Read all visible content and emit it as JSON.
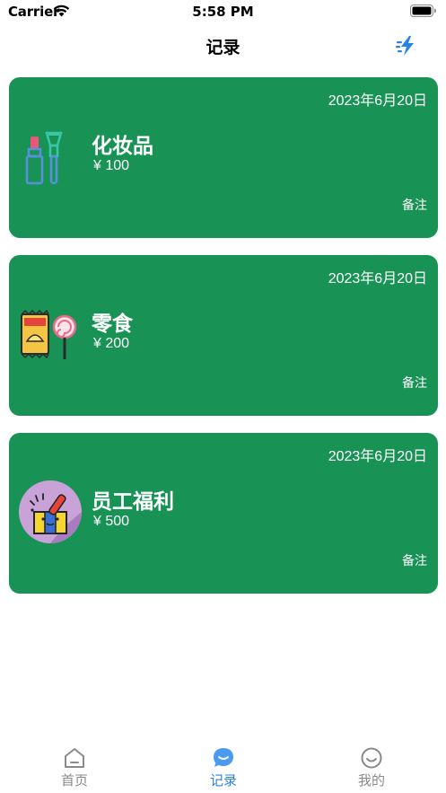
{
  "status_bar": {
    "carrier": "Carrier",
    "time": "5:58 PM"
  },
  "nav": {
    "title": "记录",
    "action_icon": "lightning-icon"
  },
  "records": [
    {
      "date": "2023年6月20日",
      "name": "化妆品",
      "amount": "¥ 100",
      "note": "备注",
      "icon": "cosmetics-icon"
    },
    {
      "date": "2023年6月20日",
      "name": "零食",
      "amount": "¥ 200",
      "note": "备注",
      "icon": "snacks-icon"
    },
    {
      "date": "2023年6月20日",
      "name": "员工福利",
      "amount": "¥ 500",
      "note": "备注",
      "icon": "gift-box-icon"
    }
  ],
  "tabs": [
    {
      "label": "首页",
      "icon": "home-icon",
      "active": false
    },
    {
      "label": "记录",
      "icon": "chat-icon",
      "active": true
    },
    {
      "label": "我的",
      "icon": "smile-icon",
      "active": false
    }
  ],
  "colors": {
    "card": "#199355",
    "accent": "#2a82e4",
    "inactive": "#8a8a8a"
  }
}
